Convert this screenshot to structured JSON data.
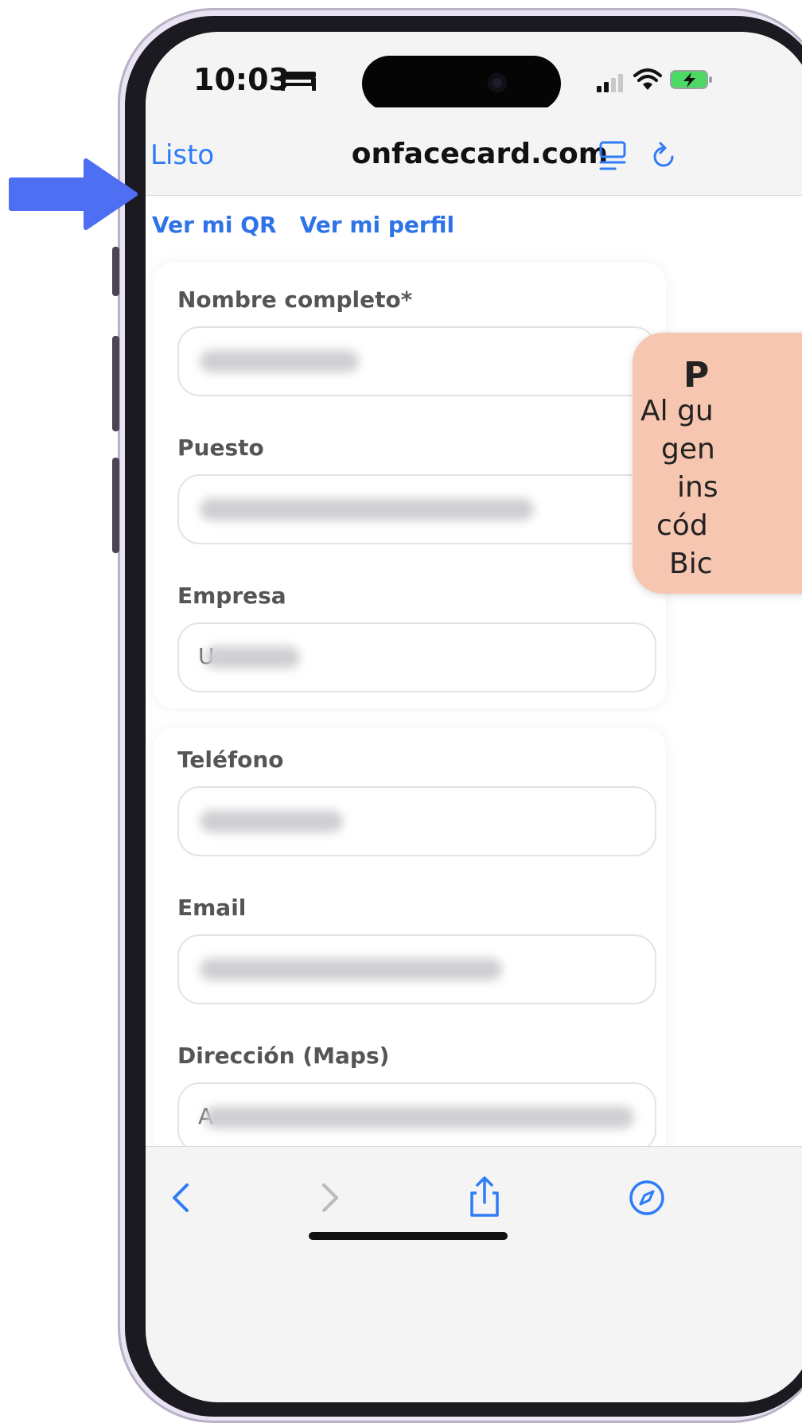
{
  "status_bar": {
    "time": "10:03"
  },
  "browser": {
    "done_label": "Listo",
    "domain": "onfacecard.com"
  },
  "page": {
    "tabs": [
      "Ver mi QR",
      "Ver mi perfil"
    ],
    "card_profile": {
      "fields": [
        {
          "label": "Nombre completo*"
        },
        {
          "label": "Puesto"
        },
        {
          "label": "Empresa",
          "visible_char": "U"
        }
      ]
    },
    "card_contact": {
      "fields": [
        {
          "label": "Teléfono"
        },
        {
          "label": "Email"
        },
        {
          "label": "Dirección (Maps)",
          "visible_char": "A"
        }
      ]
    }
  },
  "callout": {
    "title": "P",
    "lines": [
      "Al gu",
      "gen",
      "ins",
      "cód",
      "Bic"
    ],
    "color": "#f6c6b0"
  },
  "colors": {
    "accent": "#2f73e8",
    "arrow": "#4f6ff2"
  }
}
